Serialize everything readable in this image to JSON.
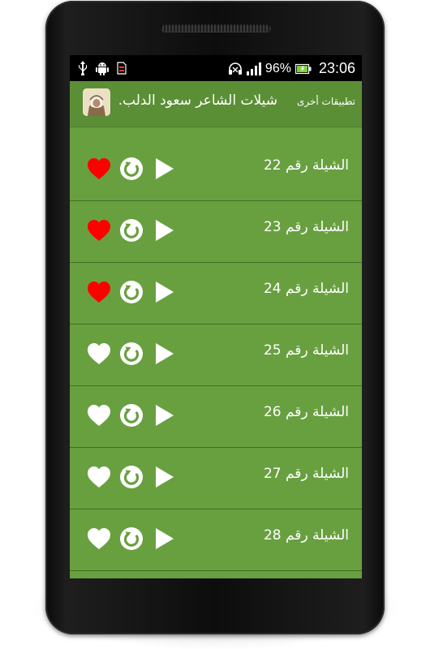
{
  "status_bar": {
    "battery_percent": "96%",
    "time": "23:06",
    "icons": [
      "usb-icon",
      "android-debug-icon",
      "sim-card-icon",
      "headset-icon",
      "signal-icon",
      "battery-icon"
    ]
  },
  "action_bar": {
    "title": "شيلات الشاعر سعود الدلب.",
    "other_apps": "تطبيقات أخرى"
  },
  "items": [
    {
      "label": "الشيلة رقم 22",
      "favorite": true
    },
    {
      "label": "الشيلة رقم 23",
      "favorite": true
    },
    {
      "label": "الشيلة رقم 24",
      "favorite": true
    },
    {
      "label": "الشيلة رقم 25",
      "favorite": false
    },
    {
      "label": "الشيلة رقم 26",
      "favorite": false
    },
    {
      "label": "الشيلة رقم 27",
      "favorite": false
    },
    {
      "label": "الشيلة رقم 28",
      "favorite": false
    }
  ],
  "colors": {
    "list_background": "#68a040",
    "action_bar": "#5b8f36",
    "favorite_on": "#ff0000",
    "favorite_off": "#ffffff"
  }
}
